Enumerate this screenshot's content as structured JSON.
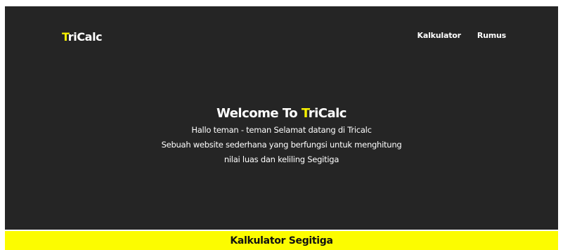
{
  "brand": {
    "prefix": "T",
    "rest": "riCalc"
  },
  "nav": {
    "items": [
      {
        "label": "Kalkulator"
      },
      {
        "label": "Rumus"
      }
    ]
  },
  "hero": {
    "title_prefix": "Welcome To ",
    "title_accent": "T",
    "title_rest": "riCalc",
    "lines": [
      "Hallo teman - teman Selamat datang di Tricalc",
      "Sebuah website sederhana yang berfungsi untuk menghitung",
      "nilai luas dan keliling Segitiga"
    ]
  },
  "section": {
    "title": "Kalkulator Segitiga"
  },
  "colors": {
    "background": "#252525",
    "accent": "#f6f000",
    "section_bar": "#fcfc00",
    "text": "#ffffff"
  }
}
